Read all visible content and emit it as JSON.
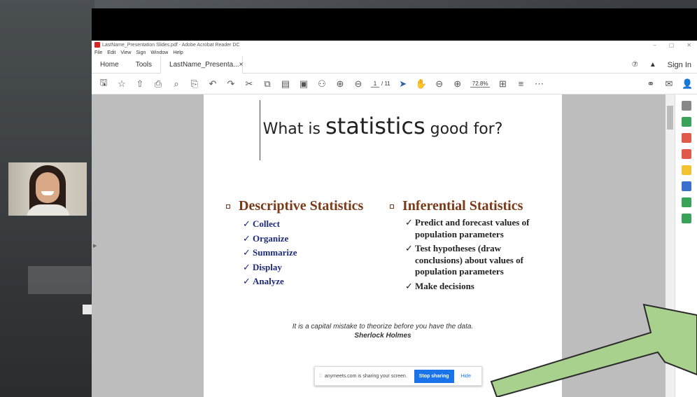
{
  "window": {
    "title": "LastName_Presentation Slides.pdf - Adobe Acrobat Reader DC",
    "controls": [
      "–",
      "▢",
      "✕"
    ]
  },
  "menu": [
    "File",
    "Edit",
    "View",
    "Sign",
    "Window",
    "Help"
  ],
  "tabs": {
    "home": "Home",
    "tools": "Tools",
    "doc": "LastName_Presenta...",
    "close": "×",
    "signin": "Sign In"
  },
  "toolbar": {
    "page_current": "1",
    "page_total": "/ 11",
    "zoom": "72.8%"
  },
  "slide": {
    "title_pre": "What is ",
    "title_big": "statistics",
    "title_post": " good for?",
    "left_heading": "Descriptive Statistics",
    "left_items": [
      "Collect",
      "Organize",
      "Summarize",
      "Display",
      "Analyze"
    ],
    "right_heading": "Inferential Statistics",
    "right_items": [
      "Predict and forecast values of population parameters",
      "Test hypotheses (draw conclusions) about values of population parameters",
      "Make decisions"
    ],
    "quote": "It is a capital mistake to theorize before you have the data.",
    "author": "Sherlock Holmes"
  },
  "share": {
    "message": "anymeets.com is sharing your screen.",
    "stop": "Stop sharing",
    "hide": "Hide"
  },
  "colors": {
    "heading": "#7a3a18",
    "items": "#1e2a7a",
    "arrow_fill": "#a9d18e",
    "share_blue": "#1a73e8"
  }
}
